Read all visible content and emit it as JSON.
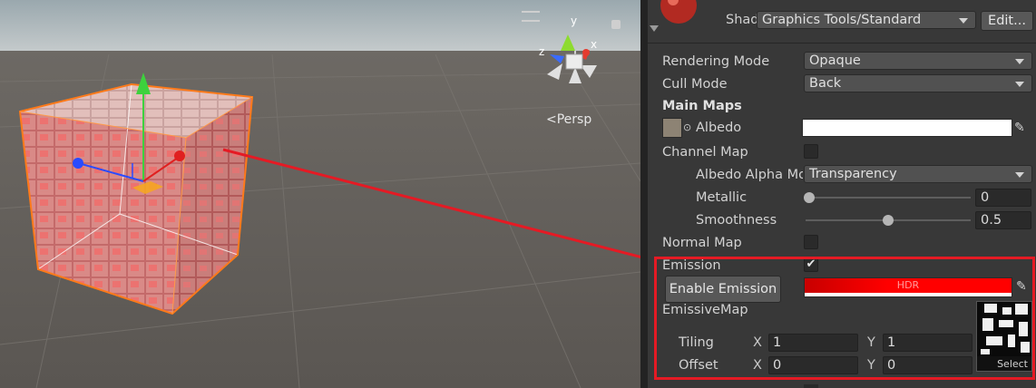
{
  "scene": {
    "view_mode": "Persp",
    "gizmo_axes": {
      "x": "x",
      "y": "y",
      "z": "z"
    }
  },
  "inspector": {
    "shader_label": "Shader",
    "shader_value": "Graphics Tools/Standard",
    "edit_button": "Edit...",
    "rendering_mode_label": "Rendering Mode",
    "rendering_mode_value": "Opaque",
    "cull_mode_label": "Cull Mode",
    "cull_mode_value": "Back",
    "main_maps_label": "Main Maps",
    "albedo_label": "Albedo",
    "channel_map_label": "Channel Map",
    "albedo_alpha_label": "Albedo Alpha Mo",
    "albedo_alpha_value": "Transparency",
    "metallic_label": "Metallic",
    "metallic_value": "0",
    "metallic_fraction": 0,
    "smoothness_label": "Smoothness",
    "smoothness_value": "0.5",
    "smoothness_fraction": 0.5,
    "normal_map_label": "Normal Map",
    "emission_label": "Emission",
    "emission_check": "✔",
    "enable_emission_button": "Enable Emission",
    "emission_color_text": "HDR",
    "emissive_map_label": "EmissiveMap",
    "tiling_label": "Tiling",
    "offset_label": "Offset",
    "x_axis": "X",
    "y_axis": "Y",
    "tiling_x": "1",
    "tiling_y": "1",
    "offset_x": "0",
    "offset_y": "0",
    "select_button": "Select"
  },
  "colors": {
    "emission_color": "#ff0000",
    "highlight": "#e51a24",
    "selection_outline": "#ff7a1a"
  }
}
